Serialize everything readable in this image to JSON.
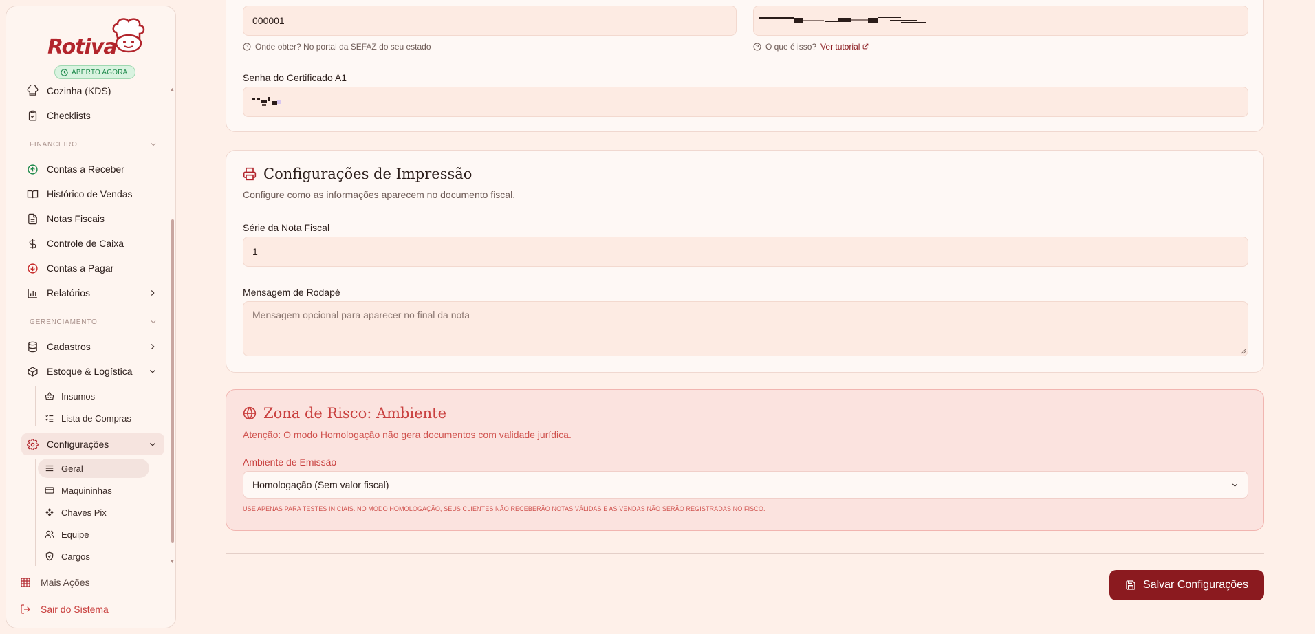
{
  "brand": {
    "name": "Rotiva",
    "status_badge": "ABERTO AGORA"
  },
  "sidebar": {
    "items_top": [
      {
        "label": "Cozinha (KDS)",
        "icon": "chef-hat-icon"
      },
      {
        "label": "Checklists",
        "icon": "clipboard-check-icon"
      }
    ],
    "financeiro": {
      "label": "FINANCEIRO",
      "items": [
        {
          "label": "Contas a Receber",
          "icon": "arrow-up-circle-icon",
          "color": "#1f8a4c"
        },
        {
          "label": "Histórico de Vendas",
          "icon": "book-icon"
        },
        {
          "label": "Notas Fiscais",
          "icon": "file-text-icon"
        },
        {
          "label": "Controle de Caixa",
          "icon": "dollar-icon"
        },
        {
          "label": "Contas a Pagar",
          "icon": "arrow-down-circle-icon",
          "color": "#c62828"
        },
        {
          "label": "Relatórios",
          "icon": "bar-chart-icon"
        }
      ]
    },
    "gerenciamento": {
      "label": "GERENCIAMENTO",
      "items": [
        {
          "label": "Cadastros",
          "icon": "database-icon"
        },
        {
          "label": "Estoque & Logística",
          "icon": "package-icon"
        }
      ],
      "estoque_sub": [
        {
          "label": "Insumos",
          "icon": "basket-icon"
        },
        {
          "label": "Lista de Compras",
          "icon": "list-checks-icon"
        }
      ],
      "config": {
        "label": "Configurações",
        "icon": "gear-icon"
      },
      "config_sub": [
        {
          "label": "Geral",
          "icon": "menu-icon",
          "active": true
        },
        {
          "label": "Maquininhas",
          "icon": "card-icon"
        },
        {
          "label": "Chaves Pix",
          "icon": "pix-icon"
        },
        {
          "label": "Equipe",
          "icon": "users-icon"
        },
        {
          "label": "Cargos",
          "icon": "shield-icon"
        }
      ]
    },
    "footer": {
      "more": "Mais Ações",
      "logout": "Sair do Sistema"
    }
  },
  "certificate_card": {
    "csc_value": "000001",
    "csc_hint": "Onde obter? No portal da SEFAZ do seu estado",
    "token_hint": "O que é isso?",
    "token_link": "Ver tutorial",
    "password_label": "Senha do Certificado A1"
  },
  "print_card": {
    "title": "Configurações de Impressão",
    "subtitle": "Configure como as informações aparecem no documento fiscal.",
    "series_label": "Série da Nota Fiscal",
    "series_value": "1",
    "footer_label": "Mensagem de Rodapé",
    "footer_placeholder": "Mensagem opcional para aparecer no final da nota"
  },
  "risk_card": {
    "title": "Zona de Risco: Ambiente",
    "subtitle": "Atenção: O modo Homologação não gera documentos com validade jurídica.",
    "env_label": "Ambiente de Emissão",
    "env_value": "Homologação (Sem valor fiscal)",
    "fine_print": "USE APENAS PARA TESTES INICIAIS. NO MODO HOMOLOGAÇÃO, SEUS CLIENTES NÃO RECEBERÃO NOTAS VÁLIDAS E AS VENDAS NÃO SERÃO REGISTRADAS NO FISCO."
  },
  "actions": {
    "save": "Salvar Configurações"
  },
  "colors": {
    "primary": "#8b1a1f",
    "brand": "#b2252c",
    "danger": "#c9403f",
    "success": "#1f8a4c"
  }
}
